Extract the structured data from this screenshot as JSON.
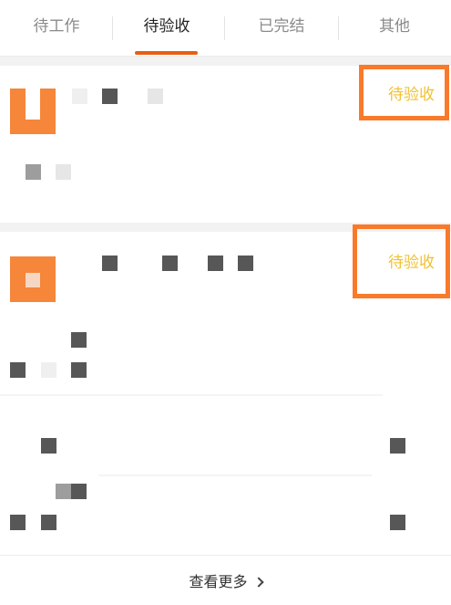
{
  "tabs": [
    {
      "label": "待工作",
      "active": false
    },
    {
      "label": "待验收",
      "active": true
    },
    {
      "label": "已完结",
      "active": false
    },
    {
      "label": "其他",
      "active": false
    }
  ],
  "cards": [
    {
      "status": "待验收"
    },
    {
      "status": "待验收"
    }
  ],
  "footer": {
    "more_label": "查看更多"
  },
  "colors": {
    "accent": "#e85d12",
    "logo": "#f5863a",
    "highlight_box": "#f97a2a",
    "status_text": "#f2c12e"
  },
  "icons": {
    "logo": "u-shaped-logo-icon",
    "more": "chevron-right-icon"
  }
}
